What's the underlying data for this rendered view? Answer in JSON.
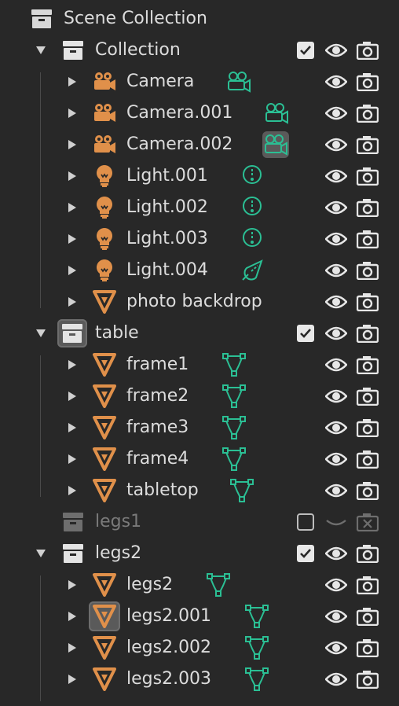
{
  "root": {
    "label": "Scene Collection"
  },
  "collections": [
    {
      "label": "Collection",
      "checked": true,
      "enabled": true,
      "children": [
        {
          "label": "Camera",
          "type": "camera"
        },
        {
          "label": "Camera.001",
          "type": "camera"
        },
        {
          "label": "Camera.002",
          "type": "camera"
        },
        {
          "label": "Light.001",
          "type": "light"
        },
        {
          "label": "Light.002",
          "type": "light"
        },
        {
          "label": "Light.003",
          "type": "light"
        },
        {
          "label": "Light.004",
          "type": "light"
        },
        {
          "label": "photo backdrop",
          "type": "mesh"
        }
      ]
    },
    {
      "label": "table",
      "checked": true,
      "enabled": true,
      "children": [
        {
          "label": "frame1",
          "type": "mesh"
        },
        {
          "label": "frame2",
          "type": "mesh"
        },
        {
          "label": "frame3",
          "type": "mesh"
        },
        {
          "label": "frame4",
          "type": "mesh"
        },
        {
          "label": "tabletop",
          "type": "mesh"
        }
      ]
    },
    {
      "label": "legs1",
      "checked": false,
      "enabled": false,
      "children": []
    },
    {
      "label": "legs2",
      "checked": true,
      "enabled": true,
      "children": [
        {
          "label": "legs2",
          "type": "mesh"
        },
        {
          "label": "legs2.001",
          "type": "mesh"
        },
        {
          "label": "legs2.002",
          "type": "mesh"
        },
        {
          "label": "legs2.003",
          "type": "mesh"
        }
      ]
    }
  ],
  "colors": {
    "background": "#282828",
    "object_icon": "#e0904a",
    "data_icon": "#2bbf94",
    "text": "#dcdcdc",
    "dim_text": "#7a7a7a"
  }
}
